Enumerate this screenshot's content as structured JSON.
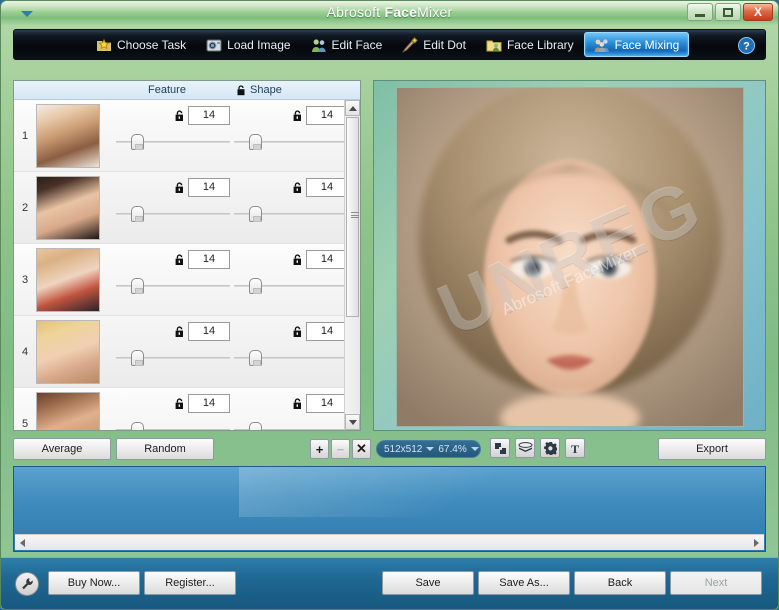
{
  "window": {
    "title_regular_1": "Abrosoft ",
    "title_bold": "Face",
    "title_regular_2": "Mixer",
    "menu_arrow_icon": "caret-down-icon",
    "minimize_label": "Minimize",
    "maximize_label": "Restore",
    "close_label": "X"
  },
  "toolbar": {
    "help_icon": "help-circle-icon",
    "tabs": [
      {
        "label": "Choose Task",
        "icon": "folder-star-icon",
        "active": false
      },
      {
        "label": "Load Image",
        "icon": "camera-icon",
        "active": false
      },
      {
        "label": "Edit Face",
        "icon": "two-people-icon",
        "active": false
      },
      {
        "label": "Edit Dot",
        "icon": "hand-pointer-icon",
        "active": false
      },
      {
        "label": "Face Library",
        "icon": "folder-people-icon",
        "active": false
      },
      {
        "label": "Face Mixing",
        "icon": "group-people-icon",
        "active": true
      }
    ]
  },
  "feature_list": {
    "header": {
      "feature_label": "Feature",
      "shape_label": "Shape",
      "shape_lock_icon": "padlock-open-icon"
    },
    "rows": [
      {
        "num": "1",
        "feature_value": "14",
        "shape_value": "14",
        "feature_lock_icon": "padlock-open-icon",
        "shape_lock_icon": "padlock-open-icon",
        "thumb_name": "face-thumbnail-1",
        "thumb_css": "linear-gradient(160deg,#f3ece6 0%,#e8c9a8 22%,#c99a72 45%,#8a5e42 70%,#f0e6dc 100%)"
      },
      {
        "num": "2",
        "feature_value": "14",
        "shape_value": "14",
        "feature_lock_icon": "padlock-open-icon",
        "shape_lock_icon": "padlock-open-icon",
        "thumb_name": "face-thumbnail-2",
        "thumb_css": "linear-gradient(160deg,#2a1d18 0%,#4a3228 18%,#e8c4a4 45%,#d8a98a 68%,#1d1512 100%)"
      },
      {
        "num": "3",
        "feature_value": "14",
        "shape_value": "14",
        "feature_lock_icon": "padlock-open-icon",
        "shape_lock_icon": "padlock-open-icon",
        "thumb_name": "face-thumbnail-3",
        "thumb_css": "linear-gradient(160deg,#e8c79c 0%,#d9b183 20%,#f0d4c0 48%,#c0543f 70%,#2a2428 100%)"
      },
      {
        "num": "4",
        "feature_value": "14",
        "shape_value": "14",
        "feature_lock_icon": "padlock-open-icon",
        "shape_lock_icon": "padlock-open-icon",
        "thumb_name": "face-thumbnail-4",
        "thumb_css": "linear-gradient(160deg,#e3c07a 0%,#edd49a 22%,#f0cfb2 50%,#d8a98c 72%,#b98a62 100%)"
      },
      {
        "num": "5",
        "feature_value": "14",
        "shape_value": "14",
        "feature_lock_icon": "padlock-open-icon",
        "shape_lock_icon": "padlock-open-icon",
        "thumb_name": "face-thumbnail-5",
        "thumb_css": "linear-gradient(160deg,#6b4030 0%,#9a6a4a 20%,#e0b08c 48%,#caa07c 70%,#3a261c 100%)"
      }
    ]
  },
  "preview": {
    "watermark_text": "UNREG",
    "watermark_sub": "Abrosoft FaceMixer",
    "image_name": "mixed-face-preview"
  },
  "midbar": {
    "average_label": "Average",
    "random_label": "Random",
    "add_label": "+",
    "remove_label": "−",
    "delete_label": "✕",
    "size_value": "512x512",
    "zoom_value": "67.4%",
    "export_label": "Export",
    "tool_icons": [
      {
        "name": "crop-resize-icon"
      },
      {
        "name": "layers-icon"
      },
      {
        "name": "gear-icon"
      },
      {
        "name": "text-tool-icon"
      }
    ]
  },
  "footer": {
    "wrench_icon": "wrench-icon",
    "buy_now_label": "Buy Now...",
    "register_label": "Register...",
    "save_label": "Save",
    "save_as_label": "Save As...",
    "back_label": "Back",
    "next_label": "Next"
  },
  "colors": {
    "accent_blue": "#2a8fd8",
    "title_green": "#9fcf96",
    "panel_blue": "#3f8cbd",
    "close_red": "#c33c1e"
  }
}
